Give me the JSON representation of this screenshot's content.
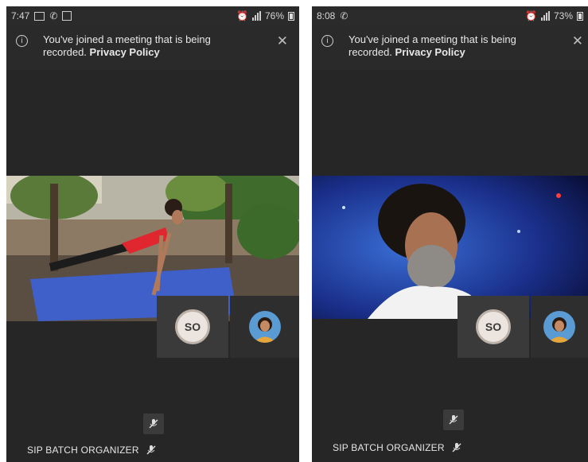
{
  "left": {
    "status": {
      "time": "7:47",
      "battery": "76%"
    },
    "banner": {
      "text": "You've joined a meeting that is being recorded.",
      "link": "Privacy Policy"
    },
    "tiles": {
      "initials": "SO"
    },
    "participant": {
      "name": "SIP BATCH ORGANIZER"
    }
  },
  "right": {
    "status": {
      "time": "8:08",
      "battery": "73%"
    },
    "banner": {
      "text": "You've joined a meeting that is being recorded.",
      "link": "Privacy Policy"
    },
    "tiles": {
      "initials": "SO"
    },
    "participant": {
      "name": "SIP BATCH ORGANIZER"
    }
  },
  "icons": [
    "info-icon",
    "close-icon",
    "mic-off-icon",
    "phone-icon"
  ],
  "colors": {
    "background": "#262626",
    "accent_mat": "#3f5fc9",
    "shirt": "#e0262e"
  }
}
